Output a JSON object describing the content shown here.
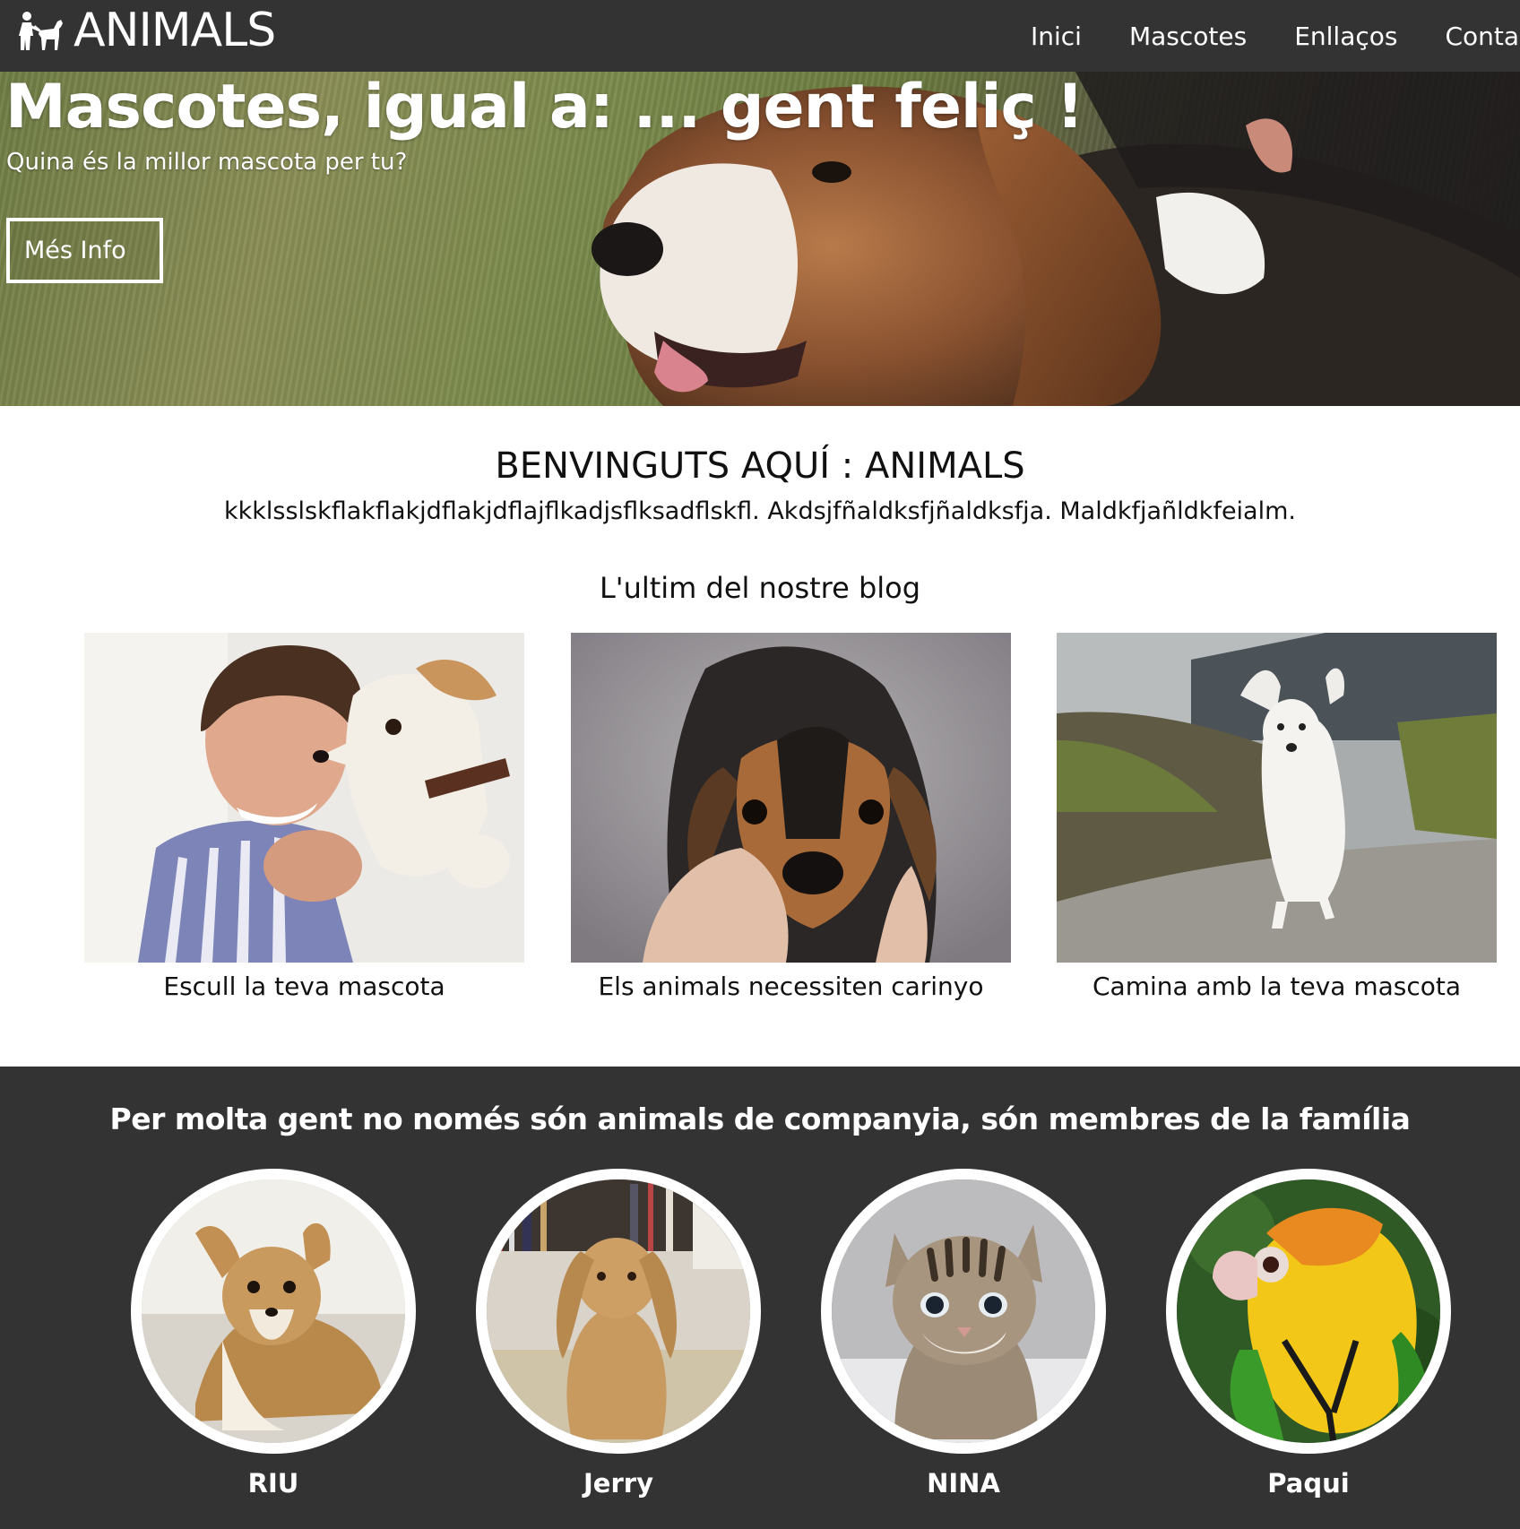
{
  "header": {
    "logo_text": "ANIMALS",
    "logo_icon": "dog-and-person-icon",
    "nav": [
      "Inici",
      "Mascotes",
      "Enllaços",
      "Contacte"
    ]
  },
  "hero": {
    "title": "Mascotes, igual a: ... gent feliç !",
    "subtitle": "Quina és la millor mascota per tu?",
    "button_label": "Més Info"
  },
  "welcome": {
    "title": "BENVINGUTS AQUÍ : ANIMALS",
    "text": "kkklsslskflakflakjdflakjdflajflkadjsflksadflskfl. Akdsjfñaldksfjñaldksfja. Maldkfjañldkfeialm."
  },
  "blog": {
    "title": "L'ultim del nostre blog",
    "posts": [
      {
        "caption": "Escull la teva mascota"
      },
      {
        "caption": "Els animals necessiten carinyo"
      },
      {
        "caption": "Camina amb la teva mascota"
      }
    ]
  },
  "family": {
    "title": "Per molta gent no només són animals de companyia, són membres de la família",
    "pets": [
      {
        "name": "RIU"
      },
      {
        "name": "Jerry"
      },
      {
        "name": "NINA"
      },
      {
        "name": "Paqui"
      }
    ]
  },
  "colors": {
    "dark_bar": "#333333",
    "text": "#111111",
    "white": "#ffffff"
  }
}
